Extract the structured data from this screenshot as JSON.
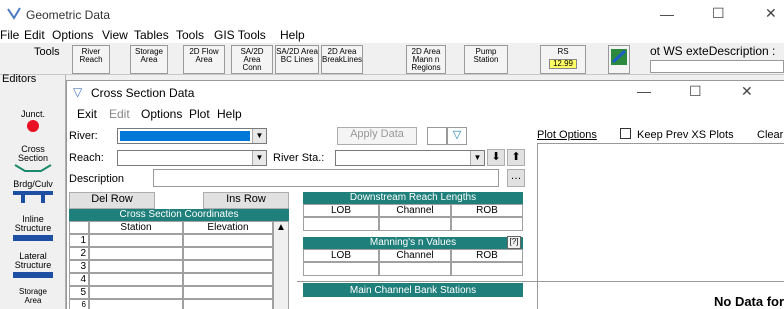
{
  "app": {
    "title": "Geometric Data",
    "menu": [
      "File",
      "Edit",
      "Options",
      "View",
      "Tables",
      "Tools",
      "GIS Tools",
      "Help"
    ]
  },
  "toolbar": {
    "tools_label": "Tools",
    "editors_label": "Editors",
    "buttons": [
      {
        "label": "River\nReach"
      },
      {
        "label": "Storage\nArea"
      },
      {
        "label": "2D Flow\nArea"
      },
      {
        "label": "SA/2D Area\nConn"
      },
      {
        "label": "SA/2D Area\nBC Lines"
      },
      {
        "label": "2D Area\nBreakLines"
      },
      {
        "label": "2D Area\nMann n\nRegions"
      },
      {
        "label": "Pump\nStation"
      },
      {
        "label": "RS"
      },
      {
        "label": ""
      }
    ],
    "rs_value": "12.99",
    "right_text": "ot WS exteDescription :"
  },
  "editors": [
    {
      "label": "Junct."
    },
    {
      "label": "Cross\nSection"
    },
    {
      "label": "Brdg/Culv"
    },
    {
      "label": "Inline\nStructure"
    },
    {
      "label": "Lateral\nStructure"
    },
    {
      "label": "Storage\nArea"
    }
  ],
  "xs": {
    "title": "Cross Section Data",
    "menu": [
      "Exit",
      "Edit",
      "Options",
      "Plot",
      "Help"
    ],
    "river_label": "River:",
    "reach_label": "Reach:",
    "river_sta_label": "River Sta.:",
    "description_label": "Description",
    "apply_data": "Apply Data",
    "del_row": "Del Row",
    "ins_row": "Ins Row",
    "coords_title": "Cross Section Coordinates",
    "coords_columns": [
      "Station",
      "Elevation"
    ],
    "rows": [
      "1",
      "2",
      "3",
      "4",
      "5",
      "6"
    ],
    "downstream_title": "Downstream Reach Lengths",
    "downstream_cols": [
      "LOB",
      "Channel",
      "ROB"
    ],
    "mannings_title": "Manning's n Values",
    "mannings_cols": [
      "LOB",
      "Channel",
      "ROB"
    ],
    "bank_title": "Main Channel Bank Stations",
    "plot_options": "Plot Options",
    "keep_prev": "Keep Prev XS Plots",
    "clear": "Clear",
    "no_data": "No Data for"
  }
}
